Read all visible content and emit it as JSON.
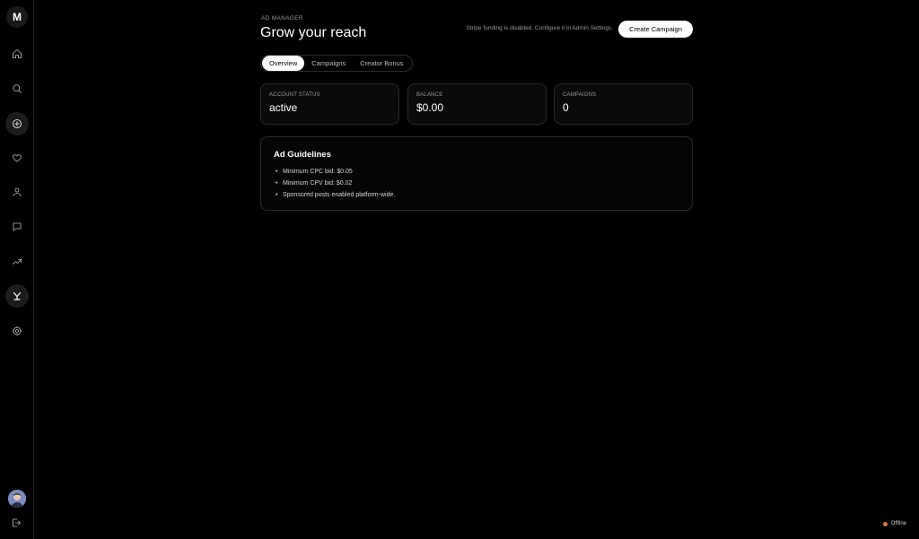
{
  "sidebar": {
    "logo": "M",
    "items": [
      {
        "name": "home-icon",
        "active": false
      },
      {
        "name": "search-icon",
        "active": false
      },
      {
        "name": "create-icon",
        "active": true
      },
      {
        "name": "heart-icon",
        "active": false
      },
      {
        "name": "user-icon",
        "active": false
      },
      {
        "name": "chat-icon",
        "active": false
      },
      {
        "name": "analytics-icon",
        "active": false
      },
      {
        "name": "ad-manager-icon",
        "active": true
      },
      {
        "name": "settings-icon",
        "active": false
      }
    ]
  },
  "header": {
    "eyebrow": "AD MANAGER",
    "title": "Grow your reach",
    "notice": "Stripe funding is disabled. Configure it in Admin Settings.",
    "create_label": "Create Campaign"
  },
  "tabs": [
    {
      "label": "Overview",
      "active": true
    },
    {
      "label": "Campaigns",
      "active": false
    },
    {
      "label": "Creator Bonus",
      "active": false
    }
  ],
  "cards": [
    {
      "label": "ACCOUNT STATUS",
      "value": "active"
    },
    {
      "label": "BALANCE",
      "value": "$0.00"
    },
    {
      "label": "CAMPAIGNS",
      "value": "0"
    }
  ],
  "guidelines": {
    "title": "Ad Guidelines",
    "items": [
      "Minimum CPC bid: $0.05",
      "Minimum CPV bid: $0.02",
      "Sponsored posts enabled platform-wide."
    ]
  },
  "status": {
    "label": "Offline",
    "color": "#e0792f"
  }
}
